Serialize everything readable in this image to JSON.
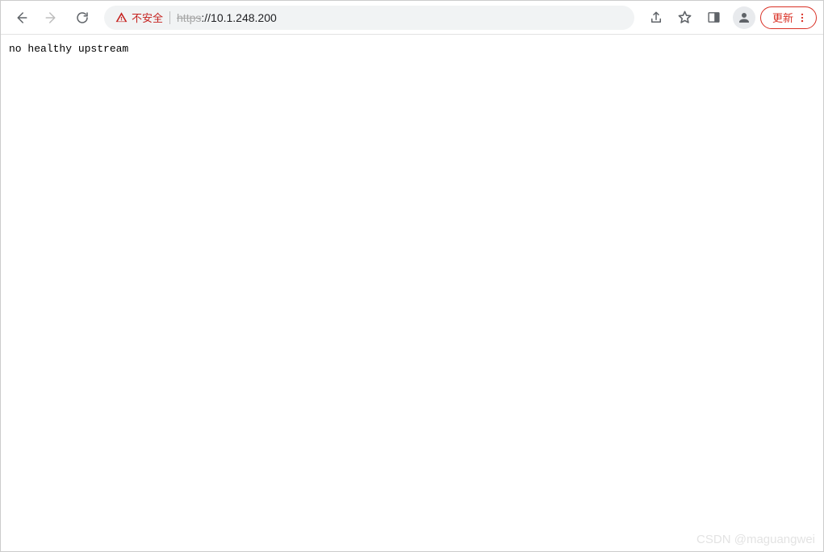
{
  "toolbar": {
    "security_label": "不安全",
    "url_protocol": "https",
    "url_rest": "://10.1.248.200",
    "update_label": "更新"
  },
  "page": {
    "body_text": "no healthy upstream"
  },
  "watermark": "CSDN @maguangwei"
}
